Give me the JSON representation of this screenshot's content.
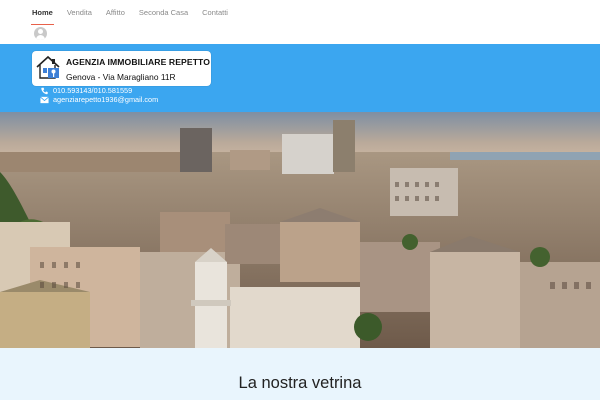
{
  "nav": {
    "items": [
      {
        "label": "Home",
        "active": true
      },
      {
        "label": "Vendita",
        "active": false
      },
      {
        "label": "Affitto",
        "active": false
      },
      {
        "label": "Seconda Casa",
        "active": false
      },
      {
        "label": "Contatti",
        "active": false
      }
    ],
    "user_icon": "user-avatar-icon"
  },
  "header": {
    "agency_name": "AGENZIA IMMOBILIARE REPETTO",
    "address": "Genova - Via Maragliano 11R",
    "phone": "010.593143/010.581559",
    "email": "agenziarepetto1936@gmail.com",
    "phone_icon": "phone-icon",
    "email_icon": "envelope-icon",
    "logo_icon": "house-key-icon"
  },
  "hero": {
    "image": "aerial-view-of-genova-rooftops"
  },
  "showcase": {
    "title": "La nostra vetrina"
  },
  "colors": {
    "header_blue": "#3ba6f0",
    "active_underline": "#e8614a",
    "showcase_bg": "#e9f5fd"
  }
}
